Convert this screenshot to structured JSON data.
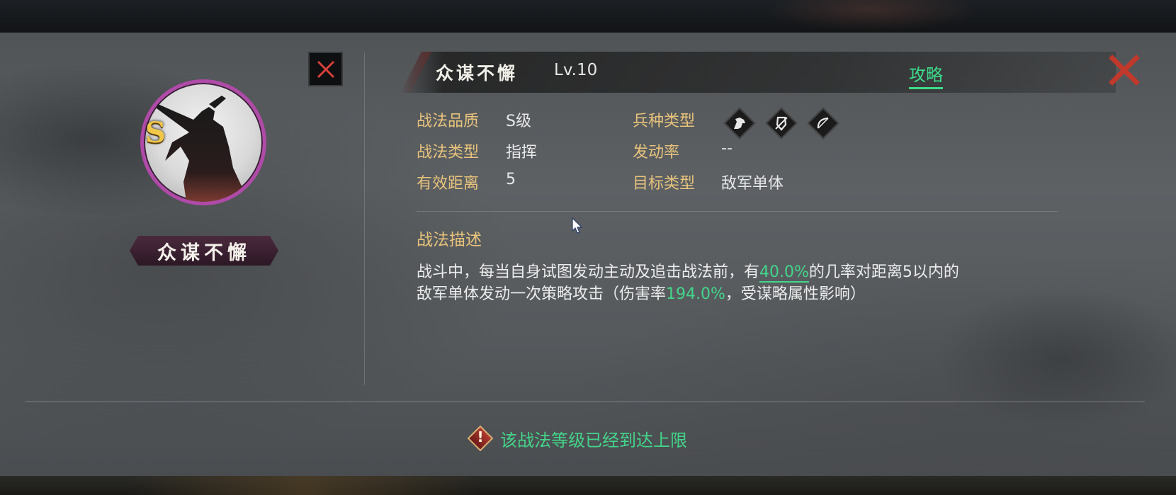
{
  "skill": {
    "name": "众谋不懈",
    "level": "Lv.10",
    "grade_badge": "S",
    "plate_name": "众谋不懈",
    "guide_label": "攻略"
  },
  "attributes": {
    "quality_label": "战法品质",
    "quality_value": "S级",
    "type_label": "战法类型",
    "type_value": "指挥",
    "range_label": "有效距离",
    "range_value": "5",
    "unit_label": "兵种类型",
    "unit_icons": [
      "cavalry-icon",
      "shield-icon",
      "bow-icon"
    ],
    "trigger_label": "发动率",
    "trigger_value": "--",
    "target_label": "目标类型",
    "target_value": "敌军单体"
  },
  "description": {
    "title": "战法描述",
    "part1": "战斗中，每当自身试图发动主动及追击战法前，有",
    "chance": "40.0%",
    "part2": "的几率对距离5以内的",
    "part3": "敌军单体发动一次策略攻击（伤害率",
    "damage": "194.0%",
    "part4": "，受谋略属性影响）"
  },
  "notice": {
    "icon": "warning-icon",
    "mark": "!",
    "text": "该战法等级已经到达上限"
  },
  "colors": {
    "accent_green": "#43d68a",
    "label_gold": "#e8c37c",
    "close_red": "#c0392b",
    "portrait_ring": "#b04aa8"
  }
}
